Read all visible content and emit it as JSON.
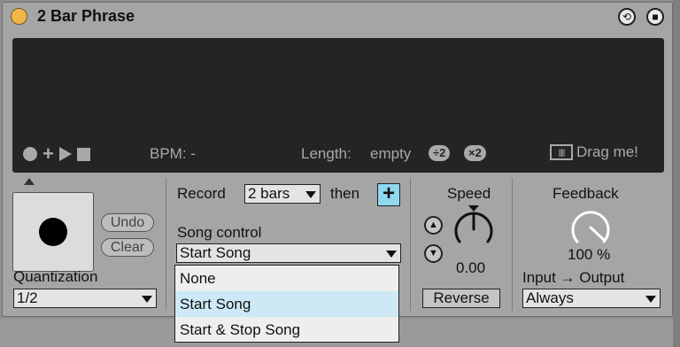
{
  "device": {
    "title": "2 Bar Phrase",
    "title_dot_color": "#f4b548",
    "buttons": [
      {
        "icon": "refresh-icon",
        "glyph": "⟲"
      },
      {
        "icon": "save-icon",
        "glyph": "■"
      }
    ]
  },
  "display": {
    "bpm_label": "BPM: -",
    "length_label": "Length:",
    "length_value": "empty",
    "half_label": "÷2",
    "double_label": "×2",
    "drag_label": "Drag me!",
    "drag_icon_glyph": "|||||"
  },
  "quantization": {
    "label": "Quantization",
    "value": "1/2",
    "undo_label": "Undo",
    "clear_label": "Clear"
  },
  "record": {
    "label": "Record",
    "bars_value": "2 bars",
    "then_label": "then",
    "plus_glyph": "+",
    "accent_color": "#8fd8f0"
  },
  "song_control": {
    "label": "Song control",
    "value": "Start Song",
    "options": [
      "None",
      "Start Song",
      "Start & Stop Song"
    ],
    "selected_index": 1
  },
  "speed": {
    "label": "Speed",
    "value": "0.00",
    "up_glyph": "▲",
    "down_glyph": "▼",
    "reverse_label": "Reverse"
  },
  "feedback": {
    "label": "Feedback",
    "value": "100 %",
    "level_fraction": 1.0,
    "io_label": "Input → Output",
    "io_value": "Always"
  }
}
